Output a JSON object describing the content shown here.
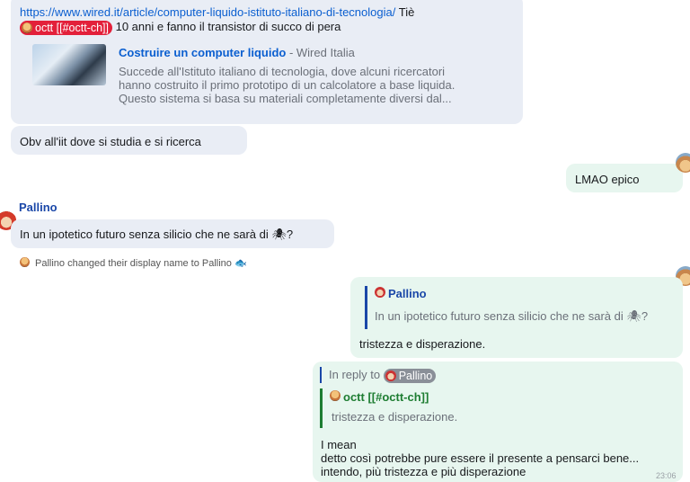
{
  "msg1": {
    "url": "https://www.wired.it/article/computer-liquido-istituto-italiano-di-tecnologia/",
    "after_url": "Tiè",
    "pill": "octt [[#octt-ch]]",
    "tail": "10 anni e fanno il transistor di succo di pera",
    "preview": {
      "title": "Costruire un computer liquido",
      "site": " - Wired Italia",
      "line1": "Succede all'Istituto italiano di tecnologia, dove alcuni ricercatori",
      "line2": "hanno costruito il primo prototipo di un calcolatore a base liquida.",
      "line3": "Questo sistema si basa su materiali completamente diversi dal..."
    }
  },
  "msg2": {
    "text": "Obv all'iit dove si studia e si ricerca"
  },
  "msg3": {
    "text": "LMAO epico"
  },
  "msg4": {
    "sender": "Pallino",
    "text": "In un ipotetico futuro senza silicio che ne sarà di 🕷?"
  },
  "event": {
    "text": "Pallino changed their display name to Pallino 🐟"
  },
  "msg5": {
    "quote_sender": "Pallino",
    "quote_text": "In un ipotetico futuro senza silicio che ne sarà di 🕷?",
    "text": "tristezza e disperazione."
  },
  "msg6": {
    "in_reply_to": "In reply to",
    "reply_pill": "Pallino",
    "quote_sender": "octt [[#octt-ch]]",
    "quote_text": "tristezza e disperazione.",
    "line1": "I mean",
    "line2": "detto così potrebbe pure essere il presente a pensarci bene...",
    "line3": "intendo, più tristezza e più disperazione",
    "time": "23:06"
  },
  "colors": {
    "incoming_bubble": "#e9edf5",
    "outgoing_bubble": "#e7f6ef",
    "link": "#0b5fd0",
    "sender": "#1a47a8",
    "pill_red": "#e3203a"
  }
}
